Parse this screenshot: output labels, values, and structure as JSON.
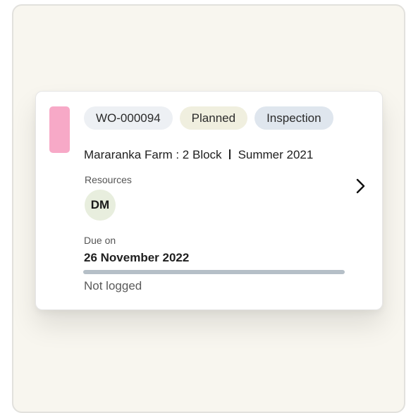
{
  "work_order": {
    "id": "WO-000094",
    "status": "Planned",
    "type": "Inspection",
    "farm_block": "Mararanka Farm : 2 Block",
    "season": "Summer 2021",
    "resources_label": "Resources",
    "resource_initials": "DM",
    "due_label": "Due on",
    "due_date": "26 November 2022",
    "progress_fraction": 0,
    "log_status": "Not logged"
  },
  "colors": {
    "status_stripe": "#f7a9c7",
    "chip_id_bg": "#edf0f4",
    "chip_status_bg": "#f0efdf",
    "chip_type_bg": "#dfe6ee",
    "avatar_bg": "#e8eede",
    "progress_track": "#b5bfc7"
  },
  "icons": {
    "open_detail": "chevron-right-icon"
  }
}
